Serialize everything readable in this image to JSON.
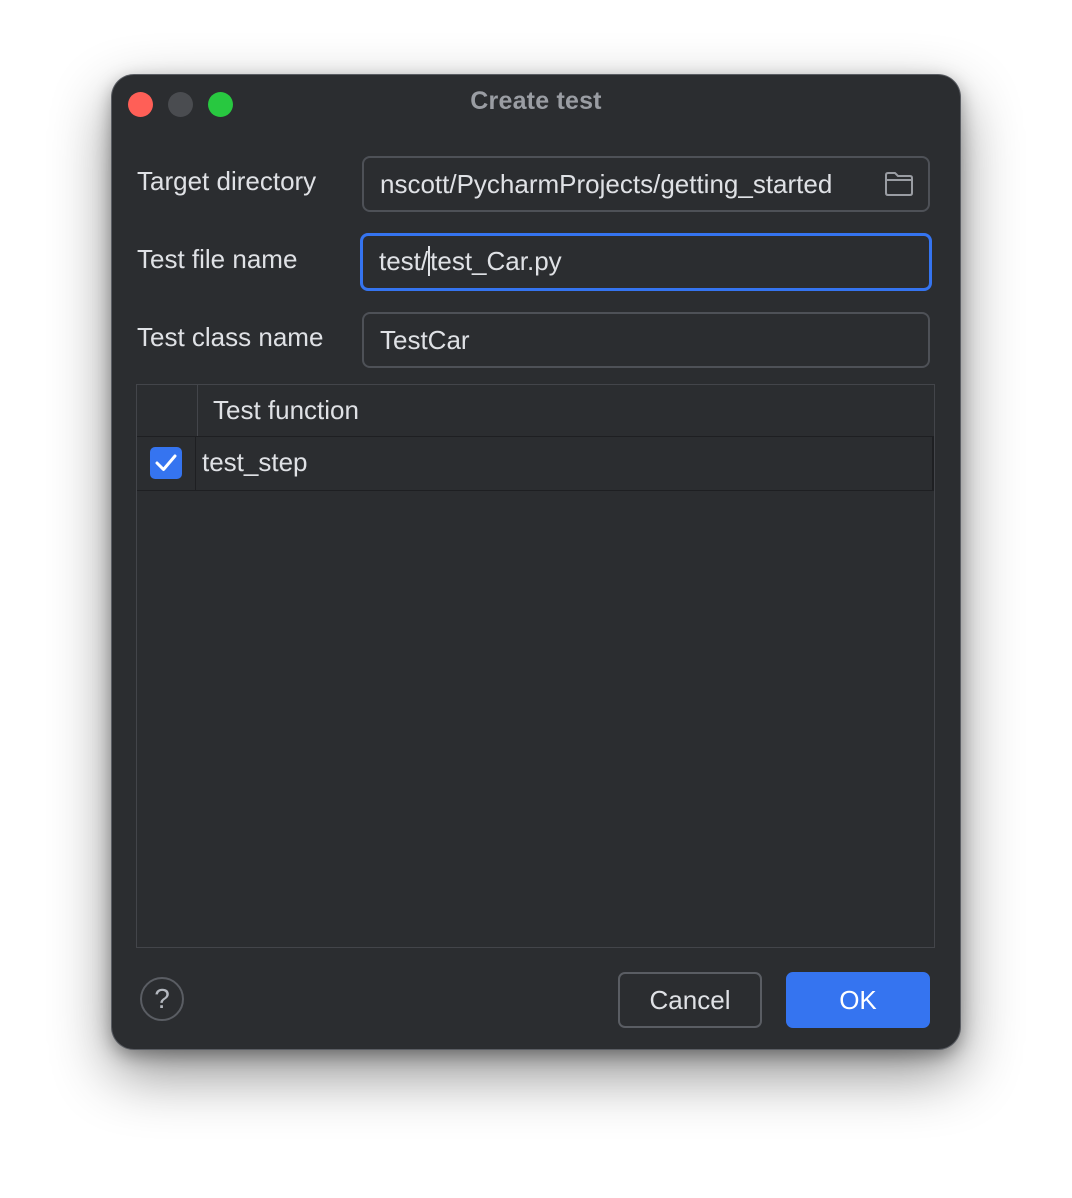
{
  "window": {
    "title": "Create test",
    "controls": [
      "close",
      "minimize",
      "zoom"
    ]
  },
  "form": {
    "target_directory": {
      "label": "Target directory",
      "value": "nscott/PycharmProjects/getting_started",
      "icon": "folder-icon"
    },
    "test_file_name": {
      "label": "Test file name",
      "value_before_caret": "test/",
      "value_after_caret": "test_Car.py"
    },
    "test_class_name": {
      "label": "Test class name",
      "value": "TestCar"
    }
  },
  "table": {
    "header": "Test function",
    "rows": [
      {
        "checked": true,
        "name": "test_step"
      }
    ]
  },
  "footer": {
    "help_label": "?",
    "cancel_label": "Cancel",
    "ok_label": "OK"
  },
  "colors": {
    "background": "#2b2d30",
    "accent": "#3574f0",
    "close": "#ff5f57",
    "minimize": "#4a4c50",
    "zoom": "#28c840",
    "text": "#dfe1e5"
  }
}
